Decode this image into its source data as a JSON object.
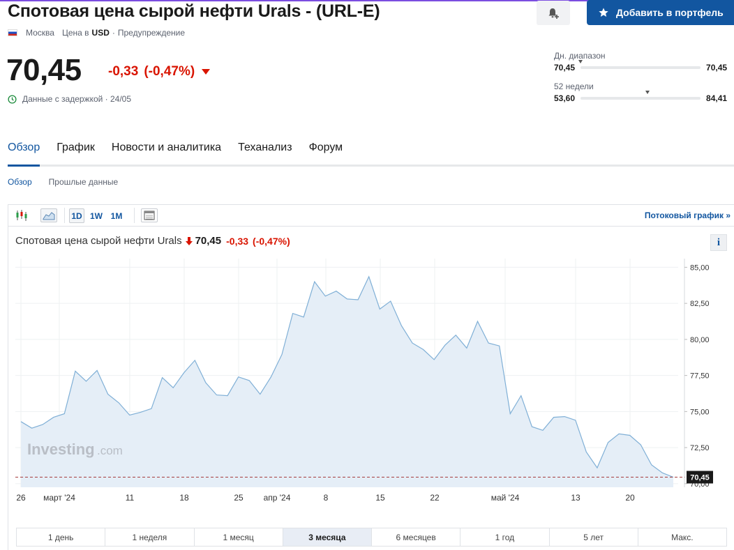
{
  "header": {
    "title": "Спотовая цена сырой нефти Urals - (URL-E)",
    "add_button": "Добавить в портфель",
    "meta_location": "Москва",
    "meta_currency_prefix": "Цена в",
    "meta_currency": "USD",
    "meta_sep": "·",
    "meta_warning": "Предупреждение"
  },
  "quote": {
    "price": "70,45",
    "change": "-0,33",
    "change_pct": "(-0,47%)",
    "delay_text": "Данные с задержкой · 24/05",
    "down_color": "#d91400"
  },
  "ranges": {
    "day": {
      "label": "Дн. диапазон",
      "low": "70,45",
      "high": "70,45",
      "position": 0.0
    },
    "week52": {
      "label": "52 недели",
      "low": "53,60",
      "high": "84,41",
      "position": 0.56
    }
  },
  "tabs": [
    "Обзор",
    "График",
    "Новости и аналитика",
    "Теханализ",
    "Форум"
  ],
  "subtabs": [
    "Обзор",
    "Прошлые данные"
  ],
  "toolbar": {
    "periods": [
      "1D",
      "1W",
      "1M"
    ],
    "stream_link": "Потоковый график »",
    "icons": [
      "candlestick-icon",
      "area-chart-icon",
      "calendar-icon"
    ]
  },
  "chart_header": {
    "name": "Спотовая цена сырой нефти Urals",
    "price": "70,45",
    "change": "-0,33",
    "change_pct": "(-0,47%)",
    "info": "i"
  },
  "watermark": {
    "brand": "Investing",
    "suffix": ".com"
  },
  "range_buttons": {
    "items": [
      "1 день",
      "1 неделя",
      "1 месяц",
      "3 месяца",
      "6 месяцев",
      "1 год",
      "5 лет",
      "Макс."
    ],
    "active_index": 3
  },
  "chart_data": {
    "type": "area",
    "x_ticks": [
      "26",
      "март '24",
      "11",
      "18",
      "25",
      "апр '24",
      "8",
      "15",
      "22",
      "май '24",
      "13",
      "20"
    ],
    "y_ticks": [
      "85,00",
      "82,50",
      "80,00",
      "77,50",
      "75,00",
      "72,50",
      "70,00"
    ],
    "ylim": [
      69.75,
      85.6
    ],
    "last_value_label": "70,45",
    "last_value": 70.45,
    "line_color": "#7fafd6",
    "fill_color": "#e5eef7",
    "ref_line_color": "#a63d3d",
    "values": [
      74.3,
      73.85,
      74.1,
      74.6,
      74.85,
      77.8,
      77.1,
      77.85,
      76.2,
      75.6,
      74.75,
      74.95,
      75.2,
      77.35,
      76.65,
      77.7,
      78.55,
      77.0,
      76.15,
      76.1,
      77.4,
      77.15,
      76.2,
      77.4,
      78.95,
      81.8,
      81.55,
      84.0,
      83.0,
      83.35,
      82.8,
      82.75,
      84.35,
      82.1,
      82.65,
      80.95,
      79.75,
      79.3,
      78.6,
      79.6,
      80.3,
      79.4,
      81.25,
      79.75,
      79.55,
      74.85,
      76.1,
      73.95,
      73.7,
      74.6,
      74.65,
      74.4,
      72.2,
      71.1,
      72.85,
      73.45,
      73.35,
      72.7,
      71.3,
      70.75,
      70.45
    ]
  }
}
